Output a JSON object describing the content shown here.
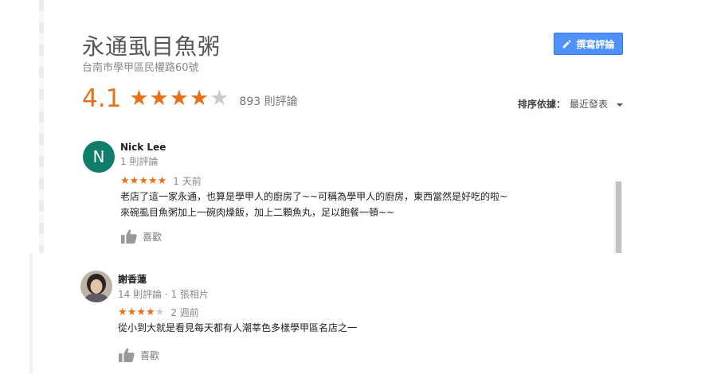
{
  "place": {
    "name": "永通虱目魚粥",
    "address": "台南市學甲區民權路60號"
  },
  "actions": {
    "write_review_label": "撰寫評論"
  },
  "summary": {
    "rating": "4.1",
    "rating_value": 4.1,
    "review_count_label": "893 則評論"
  },
  "sort": {
    "label": "排序依據：",
    "value": "最近發表"
  },
  "colors": {
    "star_accent": "#e7711b",
    "button_blue": "#4d90fe",
    "avatar_green": "#0f7d6a"
  },
  "reviews": [
    {
      "author": "Nick Lee",
      "avatar_initial": "N",
      "meta": "1 則評論",
      "stars": 5,
      "when": "1 天前",
      "text_lines": [
        "老店了這一家永通，也算是學甲人的廚房了~~可稱為學甲人的廚房，東西當然是好吃的啦~",
        "來碗虱目魚粥加上一碗肉燥飯，加上二顆魚丸，足以飽餐一頓~~"
      ],
      "like_label": "喜歡"
    },
    {
      "author": "謝香蓮",
      "avatar_icon": "profile-photo",
      "meta": "14 則評論 · 1 張相片",
      "stars": 4,
      "when": "2 週前",
      "text_lines": [
        "從小到大就是看見每天都有人潮莘色多樣學甲區名店之一"
      ],
      "like_label": "喜歡"
    }
  ]
}
